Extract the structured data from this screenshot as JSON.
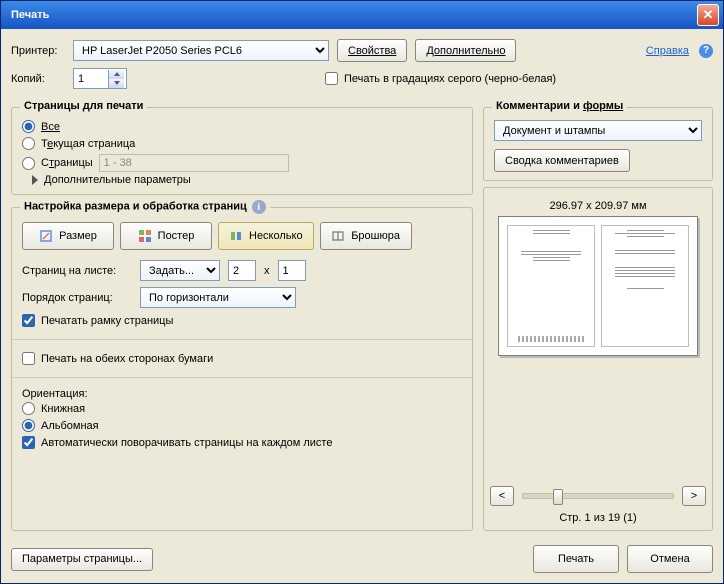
{
  "title": "Печать",
  "help_link": "Справка",
  "printer": {
    "label": "Принтер:",
    "value": "HP LaserJet P2050 Series PCL6",
    "properties": "Свойства",
    "advanced": "Дополнительно"
  },
  "copies": {
    "label": "Копий:",
    "value": "1"
  },
  "grayscale": "Печать в градациях серого (черно-белая)",
  "pages": {
    "title": "Страницы для печати",
    "all": "Все",
    "current": "Текущая страница",
    "range_label": "Страницы",
    "range_value": "1 - 38",
    "more": "Дополнительные параметры"
  },
  "sizing": {
    "title": "Настройка размера и обработка страниц",
    "size": "Размер",
    "poster": "Постер",
    "multiple": "Несколько",
    "booklet": "Брошюра",
    "per_sheet_label": "Страниц на листе:",
    "per_sheet_option": "Задать...",
    "per_sheet_w": "2",
    "per_sheet_x": "x",
    "per_sheet_h": "1",
    "order_label": "Порядок страниц:",
    "order_value": "По горизонтали",
    "frame": "Печатать рамку страницы"
  },
  "duplex": "Печать на обеих сторонах бумаги",
  "orientation": {
    "label": "Ориентация:",
    "portrait": "Книжная",
    "landscape": "Альбомная",
    "auto": "Автоматически поворачивать страницы на каждом листе"
  },
  "comments": {
    "title_a": "Комментарии и",
    "title_b": "формы",
    "value": "Документ и штампы",
    "summary": "Сводка комментариев"
  },
  "preview": {
    "dim": "296.97 x 209.97 мм",
    "prev": "<",
    "next": ">",
    "status": "Стр. 1 из 19 (1)"
  },
  "footer": {
    "page_setup": "Параметры страницы...",
    "print": "Печать",
    "cancel": "Отмена"
  }
}
